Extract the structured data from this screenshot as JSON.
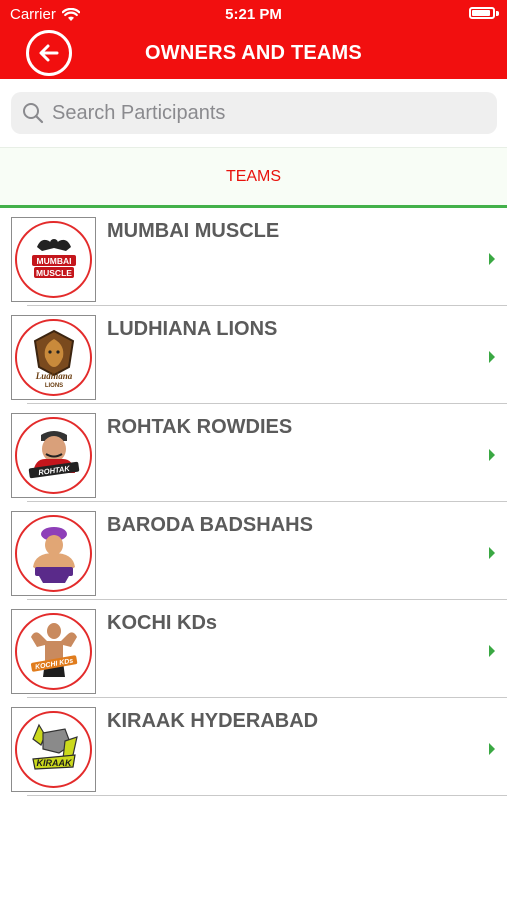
{
  "status_bar": {
    "carrier": "Carrier",
    "time": "5:21 PM"
  },
  "header": {
    "title": "OWNERS AND TEAMS",
    "back_icon": "back-arrow-circle-icon"
  },
  "search": {
    "placeholder": "Search Participants",
    "value": ""
  },
  "tabs": [
    {
      "label": "TEAMS",
      "selected": true
    }
  ],
  "teams": [
    {
      "name": "MUMBAI MUSCLE",
      "logo_icon": "mumbai-muscle-logo"
    },
    {
      "name": "LUDHIANA LIONS",
      "logo_icon": "ludhiana-lions-logo"
    },
    {
      "name": "ROHTAK ROWDIES",
      "logo_icon": "rohtak-rowdies-logo"
    },
    {
      "name": "BARODA BADSHAHS",
      "logo_icon": "baroda-badshahs-logo"
    },
    {
      "name": "KOCHI KDs",
      "logo_icon": "kochi-kds-logo"
    },
    {
      "name": "KIRAAK HYDERABAD",
      "logo_icon": "kiraak-hyderabad-logo"
    }
  ],
  "colors": {
    "header": "#f20f0f",
    "accent_green": "#43b14a",
    "tab_text": "#e8120c"
  }
}
